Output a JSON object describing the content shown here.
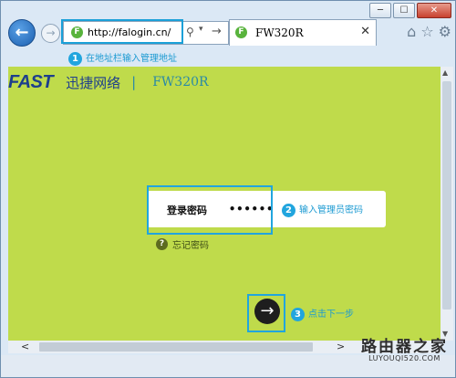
{
  "window_controls": {
    "minimize": "─",
    "maximize": "☐",
    "close": "✕"
  },
  "nav": {
    "back_glyph": "←",
    "forward_glyph": "→",
    "address_url": "http://falogin.cn/",
    "site_icon_letter": "F",
    "search_glyph": "⚲",
    "dropdown_glyph": "▾",
    "go_glyph": "→"
  },
  "tab": {
    "title": "FW320R",
    "close": "✕",
    "icon_letter": "F"
  },
  "tools": {
    "home": "⌂",
    "favorites": "☆",
    "settings": "⚙"
  },
  "callouts": [
    {
      "num": "1",
      "text": "在地址栏输入管理地址"
    },
    {
      "num": "2",
      "text": "输入管理员密码"
    },
    {
      "num": "3",
      "text": "点击下一步"
    }
  ],
  "brand": {
    "logo": "FAST",
    "slogan": "迅捷网络",
    "separator": "|",
    "model": "FW320R"
  },
  "login": {
    "label": "登录密码",
    "password_value": "••••••"
  },
  "forgot": {
    "icon": "?",
    "text": "忘记密码"
  },
  "next_glyph": "→",
  "scroll": {
    "up": "▲",
    "down": "▼",
    "left": "<",
    "right": ">"
  },
  "watermark": {
    "main": "路由器之家",
    "sub": "LUYOUQI520.COM"
  },
  "colors": {
    "page_bg": "#bfdb4b",
    "accent": "#21a5de",
    "brand_blue": "#1d3e8c"
  }
}
